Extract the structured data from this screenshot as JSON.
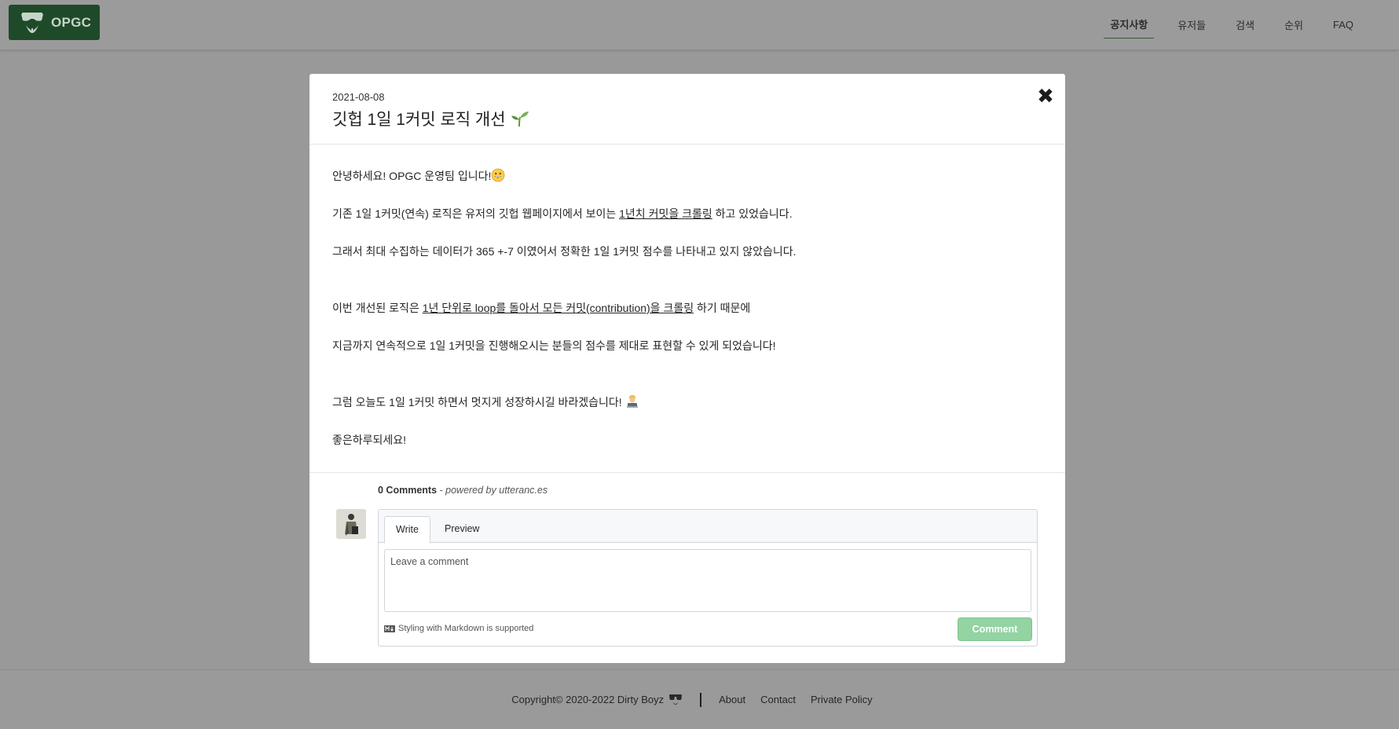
{
  "header": {
    "logo_text": "OPGC",
    "nav": [
      {
        "label": "공지사항",
        "active": true
      },
      {
        "label": "유저들"
      },
      {
        "label": "검색"
      },
      {
        "label": "순위"
      },
      {
        "label": "FAQ"
      }
    ]
  },
  "modal": {
    "date": "2021-08-08",
    "title": "깃헙 1일 1커밋 로직 개선",
    "title_icon": "sprout-icon",
    "close_label": "✖",
    "body": {
      "p1": "안녕하세요! OPGC 운영팀 입니다!",
      "p2_pre": "기존 1일 1커밋(연속) 로직은 유저의 깃헙 웹페이지에서 보이는 ",
      "p2_link": "1년치 커밋을 크롤링",
      "p2_post": " 하고 있었습니다.",
      "p3": "그래서 최대 수집하는 데이터가 365 +-7 이였어서 정확한 1일 1커밋 점수를 나타내고 있지 않았습니다.",
      "p4_pre": "이번 개선된 로직은 ",
      "p4_link": "1년 단위로 loop를 돌아서 모든 커밋(contribution)을 크롤링",
      "p4_post": " 하기 때문에",
      "p5": "지금까지 연속적으로 1일 1커밋을 진행해오시는 분들의 점수를 제대로 표현할 수 있게 되었습니다!",
      "p6": "그럼 오늘도 1일 1커밋 하면서 멋지게 성장하시길 바라겠습니다! ",
      "p7": "좋은하루되세요!"
    },
    "comments": {
      "count": "0 Comments",
      "powered": " - powered by utteranc.es",
      "tabs": {
        "write": "Write",
        "preview": "Preview"
      },
      "placeholder": "Leave a comment",
      "markdown_hint": "Styling with Markdown is supported",
      "submit": "Comment"
    }
  },
  "footer": {
    "copyright": "Copyright© 2020-2022 Dirty Boyz",
    "links": [
      "About",
      "Contact",
      "Private Policy"
    ]
  }
}
